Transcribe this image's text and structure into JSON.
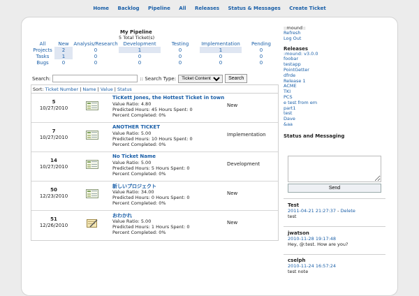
{
  "nav": [
    "Home",
    "Backlog",
    "Pipeline",
    "All",
    "Releases",
    "Status & Messages",
    "Create Ticket"
  ],
  "pipeline": {
    "title": "My Pipeline",
    "subtitle": "5 Total Ticket(s)",
    "columns": [
      "All",
      "New",
      "Analysis/Research",
      "Development",
      "Testing",
      "Implementation",
      "Pending"
    ],
    "rows": [
      {
        "label": "Projects",
        "values": [
          "2",
          "0",
          "1",
          "0",
          "1",
          "0"
        ]
      },
      {
        "label": "Tasks",
        "values": [
          "1",
          "0",
          "0",
          "0",
          "0",
          "0"
        ]
      },
      {
        "label": "Bugs",
        "values": [
          "0",
          "0",
          "0",
          "0",
          "0",
          "0"
        ]
      }
    ]
  },
  "search": {
    "label": "Search:",
    "type_label": ":: Search Type:",
    "type_value": "Ticket Content",
    "button": "Search"
  },
  "sort": {
    "label": "Sort:",
    "options": [
      "Ticket Number",
      "Name",
      "Value",
      "Status"
    ]
  },
  "tickets": [
    {
      "number": "5",
      "date": "10/27/2010",
      "title": "TicKett Jones, the Hottest Ticket in town",
      "value_ratio": "Value Ratio: 4.80",
      "hours": "Predicted Hours: 45 Hours Spent: 0",
      "percent": "Percent Completed: 0%",
      "status": "New",
      "icon": "task-sheet-icon"
    },
    {
      "number": "7",
      "date": "10/27/2010",
      "title": "ANOTHER TICKET",
      "value_ratio": "Value Ratio: 5.00",
      "hours": "Predicted Hours: 10 Hours Spent: 0",
      "percent": "Percent Completed: 0%",
      "status": "Implementation",
      "icon": "task-sheet-icon"
    },
    {
      "number": "14",
      "date": "10/27/2010",
      "title": "No Ticket Name",
      "value_ratio": "Value Ratio: 5.00",
      "hours": "Predicted Hours: 5 Hours Spent: 0",
      "percent": "Percent Completed: 0%",
      "status": "Development",
      "icon": "task-sheet-icon"
    },
    {
      "number": "50",
      "date": "12/23/2010",
      "title": "新しいプロジェクト",
      "value_ratio": "Value Ratio: 34.00",
      "hours": "Predicted Hours: 0 Hours Spent: 0",
      "percent": "Percent Completed: 0%",
      "status": "New",
      "icon": "task-sheet-icon"
    },
    {
      "number": "51",
      "date": "12/26/2010",
      "title": "おわかれ",
      "value_ratio": "Value Ratio: 5.00",
      "hours": "Predicted Hours: 1 Hours Spent: 0",
      "percent": "Percent Completed: 0%",
      "status": "New",
      "icon": "notepad-icon"
    }
  ],
  "sidebar": {
    "user_header": "::mound::",
    "refresh": "Refresh",
    "logout": "Log Out",
    "releases_header": "Releases",
    "releases": [
      ":mound: v3.0.0",
      "foobar",
      "testapp",
      "PointGetter",
      "dfrde",
      "Release 1",
      "ACME",
      "TKI",
      "PCS",
      "e test from em",
      "part1",
      "test",
      "Dave",
      "&aa"
    ],
    "status_header": "Status and Messaging",
    "send_button": "Send",
    "messages": [
      {
        "user": "Test",
        "time": "2011-04-21 21:27:37",
        "delete": "Delete",
        "text": "test"
      },
      {
        "user": "jwatson",
        "time": "2010-11-28 19:17:48",
        "text": "Hey, @:test. How are you?"
      },
      {
        "user": "cselph",
        "time": "2010-11-24 16:57:24",
        "text": "test note"
      }
    ]
  }
}
